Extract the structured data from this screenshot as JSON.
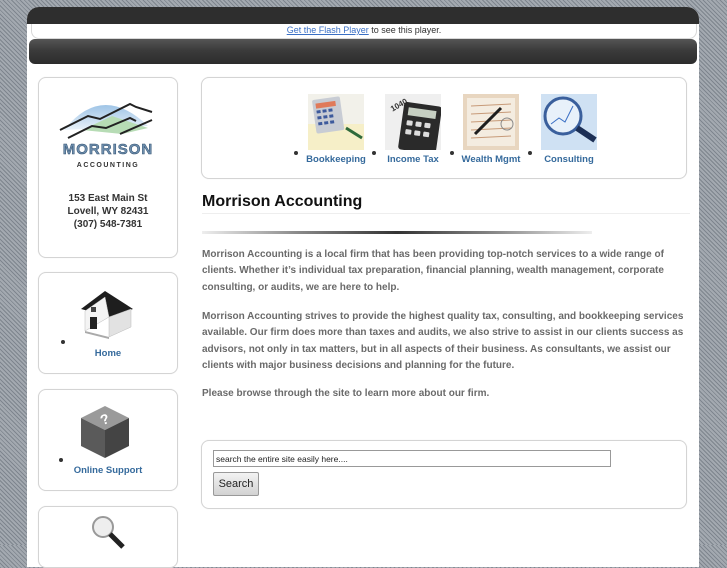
{
  "flash": {
    "link_text": "Get the Flash Player",
    "suffix_text": " to see this player."
  },
  "logo": {
    "name_line1": "MORRISON",
    "name_line2": "ACCOUNTING"
  },
  "address": {
    "street": "153 East Main St",
    "city": "Lovell, WY 82431",
    "phone": "(307) 548-7381"
  },
  "sidebar": {
    "items": [
      {
        "label": "Home",
        "icon": "house-icon"
      },
      {
        "label": "Online Support",
        "icon": "help-cube-icon"
      },
      {
        "label": "",
        "icon": "magnifier-icon"
      }
    ]
  },
  "services": [
    {
      "label": "Bookkeeping",
      "icon": "calculator-photo"
    },
    {
      "label": "Income Tax",
      "icon": "tax-form-calculator-photo"
    },
    {
      "label": "Wealth Mgmt",
      "icon": "financial-report-pen-photo"
    },
    {
      "label": "Consulting",
      "icon": "magnifying-glass-chart-photo"
    }
  ],
  "main": {
    "title": "Morrison Accounting",
    "paragraphs": [
      "Morrison Accounting is a local firm that has been providing top-notch services to a wide range of clients. Whether it’s individual tax preparation, financial planning, wealth management, corporate consulting, or audits, we are here to help.",
      "Morrison Accounting strives to provide the highest quality tax, consulting, and bookkeeping services available. Our firm does more than taxes and audits, we also strive to assist in our clients success as advisors, not only in tax matters, but in all aspects of their business. As consultants, we assist our clients with major business decisions and planning for the future.",
      "Please browse through the site to learn more about our firm."
    ]
  },
  "search": {
    "value": "search the entire site easily here....",
    "button_label": "Search"
  },
  "colors": {
    "link": "#356a9c",
    "header_bar": "#2e2e2e",
    "body_text": "#6a6a6a"
  }
}
